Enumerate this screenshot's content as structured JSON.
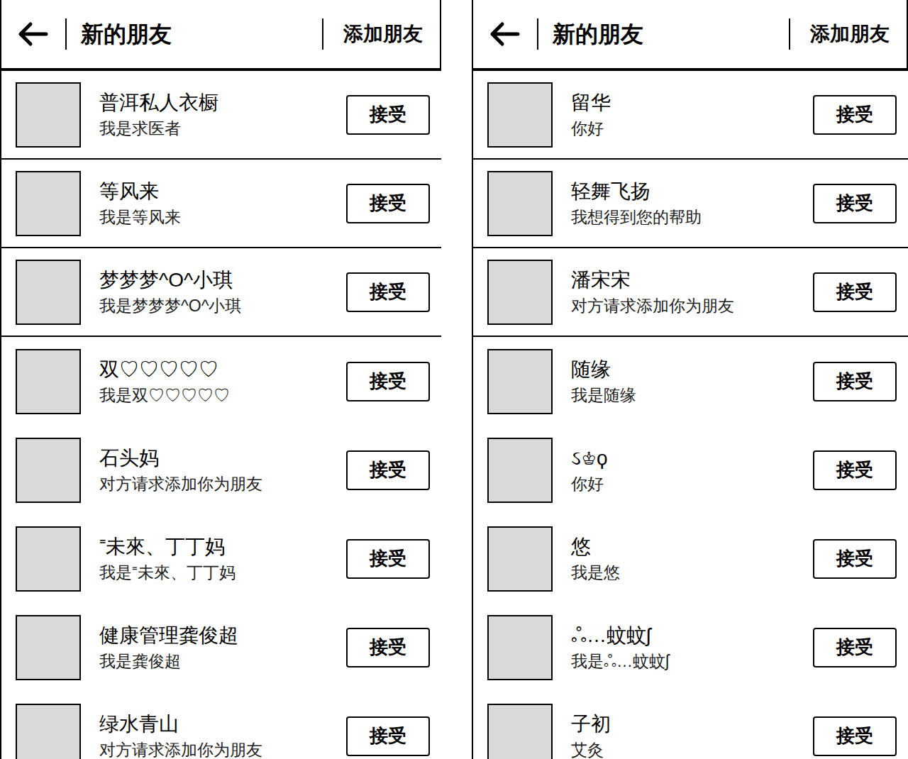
{
  "screens": [
    {
      "header": {
        "title": "新的朋友",
        "action": "添加朋友"
      },
      "requests": [
        {
          "name": "普洱私人衣橱",
          "message": "我是求医者",
          "button": "接受"
        },
        {
          "name": "等风来",
          "message": "我是等风来",
          "button": "接受"
        },
        {
          "name": "梦梦梦^O^小琪",
          "message": "我是梦梦梦^O^小琪",
          "button": "接受"
        },
        {
          "name": "双♡♡♡♡♡",
          "message": "我是双♡♡♡♡♡",
          "button": "接受"
        },
        {
          "name": "石头妈",
          "message": "对方请求添加你为朋友",
          "button": "接受"
        },
        {
          "name": "⁼未來、丁丁妈",
          "message": "我是⁼未來、丁丁妈",
          "button": "接受"
        },
        {
          "name": "健康管理龚俊超",
          "message": "我是龚俊超",
          "button": "接受"
        },
        {
          "name": "绿水青山",
          "message": "对方请求添加你为朋友",
          "button": "接受"
        }
      ]
    },
    {
      "header": {
        "title": "新的朋友",
        "action": "添加朋友"
      },
      "requests": [
        {
          "name": "留华",
          "message": "你好",
          "button": "接受"
        },
        {
          "name": "轻舞飞扬",
          "message": "我想得到您的帮助",
          "button": "接受"
        },
        {
          "name": "潘宋宋",
          "message": "对方请求添加你为朋友",
          "button": "接受"
        },
        {
          "name": "随缘",
          "message": "我是随缘",
          "button": "接受"
        },
        {
          "name": "ઽ♔ϙ",
          "message": "你好",
          "button": "接受"
        },
        {
          "name": "悠",
          "message": "我是悠",
          "button": "接受"
        },
        {
          "name": "ஃ…蚊蚊ʃ",
          "message": "我是ஃ…蚊蚊ʃ",
          "button": "接受"
        },
        {
          "name": "子初",
          "message": "艾灸",
          "button": "接受"
        }
      ]
    }
  ]
}
